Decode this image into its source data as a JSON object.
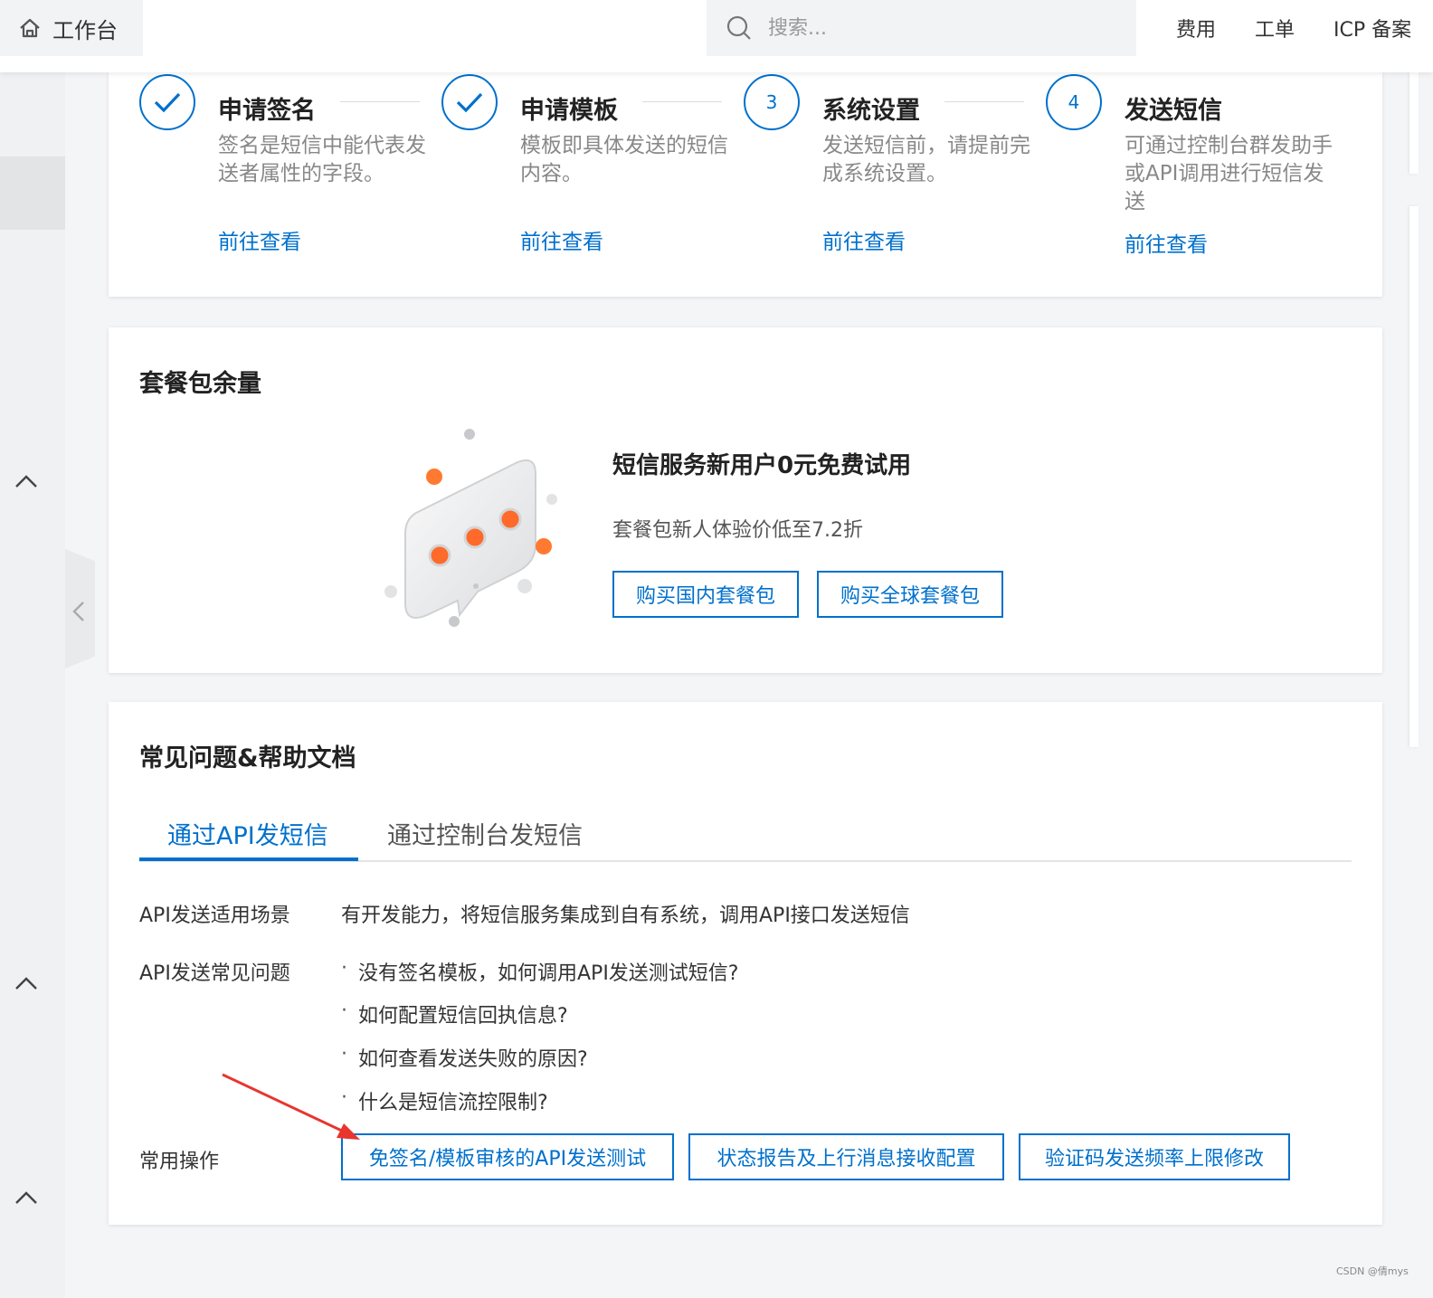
{
  "header": {
    "workbench_label": "工作台",
    "search_placeholder": "搜索...",
    "nav": [
      "费用",
      "工单",
      "ICP 备案"
    ]
  },
  "steps": [
    {
      "marker": "check",
      "title": "申请签名",
      "desc": "签名是短信中能代表发送者属性的字段。",
      "link": "前往查看"
    },
    {
      "marker": "check",
      "title": "申请模板",
      "desc": "模板即具体发送的短信内容。",
      "link": "前往查看"
    },
    {
      "marker": "3",
      "title": "系统设置",
      "desc": "发送短信前，请提前完成系统设置。",
      "link": "前往查看"
    },
    {
      "marker": "4",
      "title": "发送短信",
      "desc": "可通过控制台群发助手或API调用进行短信发送",
      "link": "前往查看"
    }
  ],
  "package": {
    "title": "套餐包余量",
    "promo_title": "短信服务新用户0元免费试用",
    "promo_sub": "套餐包新人体验价低至7.2折",
    "buttons": [
      "购买国内套餐包",
      "购买全球套餐包"
    ]
  },
  "help": {
    "title": "常见问题&帮助文档",
    "tabs": [
      "通过API发短信",
      "通过控制台发短信"
    ],
    "active_tab": "通过API发短信",
    "scenario_label": "API发送适用场景",
    "scenario_text": "有开发能力，将短信服务集成到自有系统，调用API接口发送短信",
    "faq_label": "API发送常见问题",
    "faq": [
      "没有签名模板，如何调用API发送测试短信?",
      "如何配置短信回执信息?",
      "如何查看发送失败的原因?",
      "什么是短信流控限制?"
    ],
    "ops_label": "常用操作",
    "ops_buttons": [
      "免签名/模板审核的API发送测试",
      "状态报告及上行消息接收配置",
      "验证码发送频率上限修改"
    ]
  },
  "watermark": "CSDN @倩mys",
  "colors": {
    "accent": "#0070cc",
    "annotation_arrow": "#e8352e",
    "illustration_dot": "#ff7a30"
  },
  "icons": [
    "home-icon",
    "search-icon",
    "check-icon",
    "chevron-up-icon",
    "chevron-left-icon",
    "chat-bubble-illustration",
    "red-arrow-annotation"
  ]
}
